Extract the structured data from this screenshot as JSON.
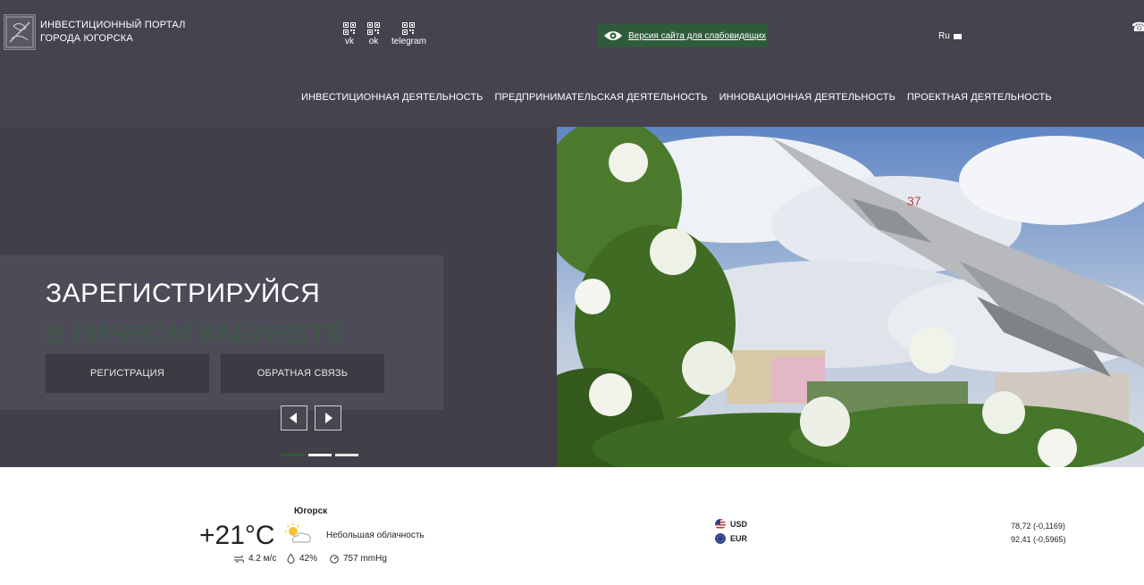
{
  "header": {
    "logo_line1": "ИНВЕСТИЦИОННЫЙ ПОРТАЛ",
    "logo_line2": "ГОРОДА ЮГОРСКА",
    "social": [
      {
        "label": "vk",
        "icon": "qr-code-icon"
      },
      {
        "label": "ok",
        "icon": "qr-code-icon"
      },
      {
        "label": "telegram",
        "icon": "qr-code-icon"
      }
    ],
    "low_vision_label": "Версия сайта для слабовидящих",
    "language": "Ru",
    "phone_icon": "☎"
  },
  "nav": [
    "ИНВЕСТИЦИОННАЯ ДЕЯТЕЛЬНОСТЬ",
    "ПРЕДПРИНИМАТЕЛЬСКАЯ ДЕЯТЕЛЬНОСТЬ",
    "ИННОВАЦИОННАЯ ДЕЯТЕЛЬНОСТЬ",
    "ПРОЕКТНАЯ ДЕЯТЕЛЬНОСТЬ"
  ],
  "hero": {
    "title": "ЗАРЕГИСТРИРУЙСЯ",
    "subtitle": "В ЛИЧНОМ КАБИНЕТЕ",
    "register_button": "РЕГИСТРАЦИЯ",
    "feedback_button": "ОБРАТНАЯ СВЯЗЬ",
    "prev_icon": "chevron-left-icon",
    "next_icon": "chevron-right-icon",
    "slides_total": 3,
    "active_slide": 2
  },
  "weather": {
    "city": "Югорск",
    "temperature": "+21°C",
    "condition": "Небольшая облачность",
    "wind": "4.2 м/с",
    "humidity": "42%",
    "pressure": "757 mmHg"
  },
  "currency": [
    {
      "code": "USD",
      "value": "78,72 (-0,1169)"
    },
    {
      "code": "EUR",
      "value": "92,41 (-0,5965)"
    }
  ],
  "colors": {
    "header_bg": "#46434f",
    "accent_green": "#2f5b3a",
    "panel_bg": "#4e4b58"
  }
}
